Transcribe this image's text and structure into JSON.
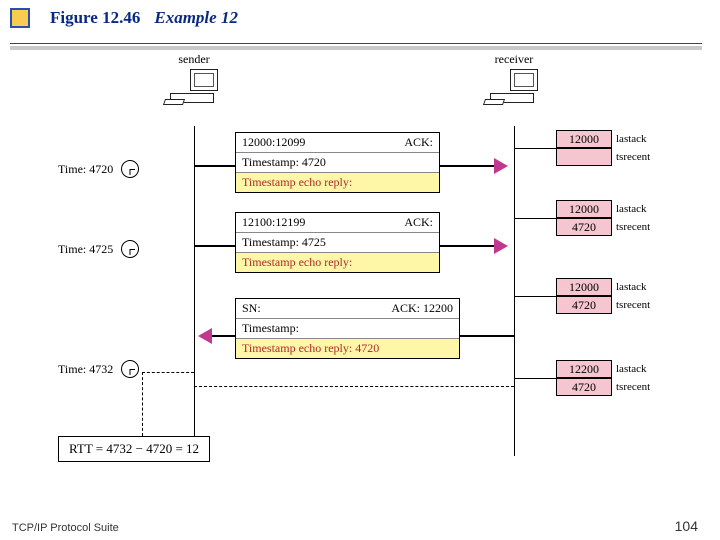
{
  "header": {
    "figure": "Figure 12.46",
    "example": "Example 12"
  },
  "roles": {
    "sender": "sender",
    "receiver": "receiver"
  },
  "times": {
    "t1": "Time: 4720",
    "t2": "Time: 4725",
    "t3": "Time: 4732"
  },
  "messages": {
    "m1": {
      "left": "12000:12099",
      "right": "ACK:",
      "mid": "Timestamp: 4720",
      "bot": "Timestamp echo reply:"
    },
    "m2": {
      "left": "12100:12199",
      "right": "ACK:",
      "mid": "Timestamp: 4725",
      "bot": "Timestamp echo reply:"
    },
    "m3": {
      "left": "SN:",
      "right": "ACK: 12200",
      "mid": "Timestamp:",
      "bot": "Timestamp echo reply: 4720"
    }
  },
  "states": {
    "s1": {
      "lastack": "12000",
      "tsrecent": ""
    },
    "s2": {
      "lastack": "12000",
      "tsrecent": "4720"
    },
    "s3": {
      "lastack": "12000",
      "tsrecent": "4720"
    },
    "s4": {
      "lastack": "12200",
      "tsrecent": "4720"
    }
  },
  "labels": {
    "lastack": "lastack",
    "tsrecent": "tsrecent"
  },
  "rtt": "RTT = 4732 − 4720 = 12",
  "footer": "TCP/IP Protocol Suite",
  "page": "104"
}
